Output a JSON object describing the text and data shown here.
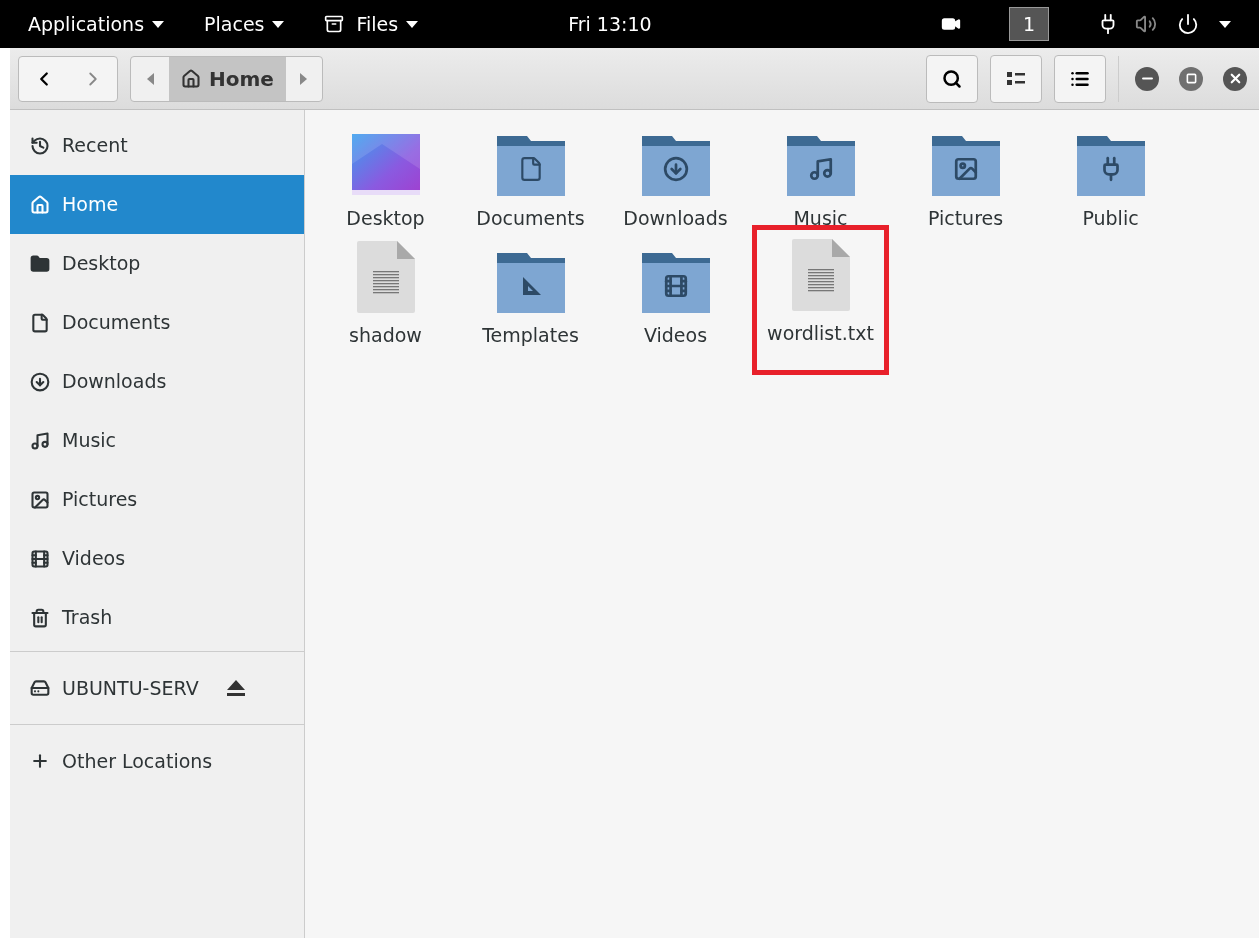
{
  "top_bar": {
    "menus": [
      "Applications",
      "Places",
      "Files"
    ],
    "clock": "Fri 13:10",
    "workspace": "1"
  },
  "header": {
    "path": [
      {
        "label": "Home",
        "selected": true
      }
    ]
  },
  "sidebar": {
    "places": [
      {
        "label": "Recent",
        "selected": false
      },
      {
        "label": "Home",
        "selected": true
      },
      {
        "label": "Desktop",
        "selected": false
      },
      {
        "label": "Documents",
        "selected": false
      },
      {
        "label": "Downloads",
        "selected": false
      },
      {
        "label": "Music",
        "selected": false
      },
      {
        "label": "Pictures",
        "selected": false
      },
      {
        "label": "Videos",
        "selected": false
      },
      {
        "label": "Trash",
        "selected": false
      }
    ],
    "devices": [
      {
        "label": "UBUNTU-SERV",
        "selected": false
      }
    ],
    "other": {
      "label": "Other Locations",
      "selected": false
    }
  },
  "files": [
    {
      "name": "Desktop",
      "kind": "desktop",
      "highlighted": false
    },
    {
      "name": "Documents",
      "kind": "folder",
      "highlighted": false
    },
    {
      "name": "Downloads",
      "kind": "folder",
      "highlighted": false
    },
    {
      "name": "Music",
      "kind": "folder",
      "highlighted": false
    },
    {
      "name": "Pictures",
      "kind": "folder",
      "highlighted": false
    },
    {
      "name": "Public",
      "kind": "folder",
      "highlighted": false
    },
    {
      "name": "shadow",
      "kind": "file",
      "highlighted": false
    },
    {
      "name": "Templates",
      "kind": "folder",
      "highlighted": false
    },
    {
      "name": "Videos",
      "kind": "folder",
      "highlighted": false
    },
    {
      "name": "wordlist.txt",
      "kind": "file",
      "highlighted": true
    }
  ]
}
